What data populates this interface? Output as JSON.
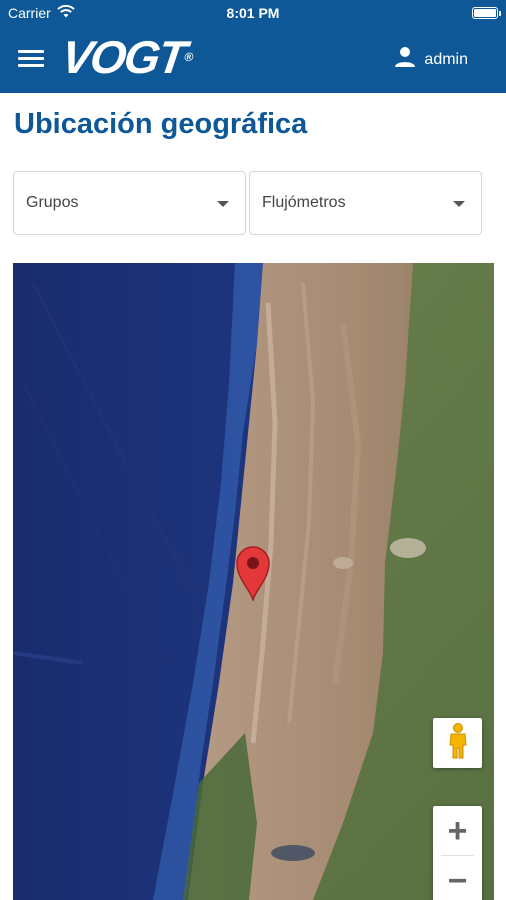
{
  "status_bar": {
    "carrier": "Carrier",
    "time": "8:01 PM"
  },
  "header": {
    "logo_text": "VOGT",
    "logo_mark": "®",
    "menu_icon": "hamburger-menu-icon",
    "user_icon": "person-icon",
    "username": "admin"
  },
  "page": {
    "title": "Ubicación geográfica"
  },
  "filters": {
    "groups": {
      "selected": "Grupos"
    },
    "flowmeters": {
      "selected": "Flujómetros"
    }
  },
  "map": {
    "marker_icon": "map-pin-icon",
    "pegman_icon": "pegman-icon",
    "zoom_in": "+",
    "zoom_out": "−"
  },
  "colors": {
    "brand_blue": "#0e5898",
    "marker_red": "#e2383a",
    "ocean": "#1c3378"
  }
}
